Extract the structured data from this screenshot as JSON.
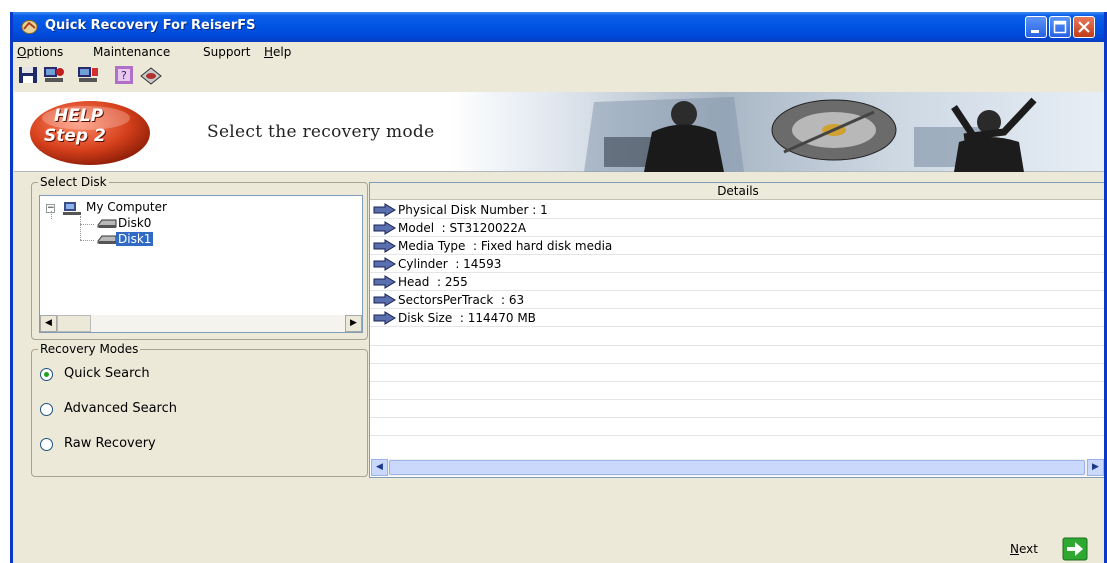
{
  "window": {
    "title": "Quick Recovery For ReiserFS"
  },
  "menu": [
    {
      "label": "Options",
      "access": "O",
      "rest": "ptions"
    },
    {
      "label": "Maintenance",
      "access": "",
      "rest": "Maintenance"
    },
    {
      "label": "Support",
      "access": "",
      "rest": "Support"
    },
    {
      "label": "Help",
      "access": "H",
      "rest": "elp"
    }
  ],
  "toolbar": {
    "icons": [
      "save-icon",
      "computer-icon",
      "computer-icon",
      "help-icon",
      "disk-icon"
    ]
  },
  "banner": {
    "badge_line1": "HELP",
    "badge_line2": "Step 2",
    "instruction": "Select the recovery mode"
  },
  "select_disk": {
    "title": "Select Disk",
    "root": "My Computer",
    "disks": [
      "Disk0",
      "Disk1"
    ],
    "selected": "Disk1"
  },
  "recovery_modes": {
    "title": "Recovery Modes",
    "options": [
      "Quick Search",
      "Advanced Search",
      "Raw Recovery"
    ],
    "selected": "Quick Search"
  },
  "details": {
    "header": "Details",
    "rows": [
      "Physical Disk Number : 1",
      "Model  : ST3120022A",
      "Media Type  : Fixed hard disk media",
      "Cylinder  : 14593",
      "Head  : 255",
      "SectorsPerTrack  : 63",
      "Disk Size  : 114470 MB"
    ]
  },
  "footer": {
    "next_access": "N",
    "next_rest": "ext"
  },
  "colors": {
    "titlebar": "#0154e3",
    "window_bg": "#ece9d8",
    "selection": "#316ac5",
    "next_arrow": "#2fa832"
  }
}
